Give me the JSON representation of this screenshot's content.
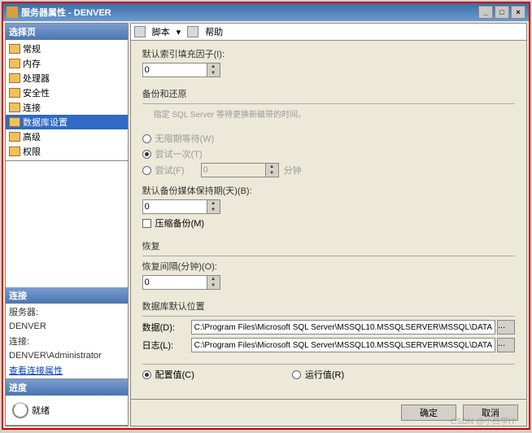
{
  "window": {
    "icon": "server-icon",
    "title": "服务器属性 - DENVER"
  },
  "sidebar": {
    "select_header": "选择页",
    "items": [
      {
        "label": "常规"
      },
      {
        "label": "内存"
      },
      {
        "label": "处理器"
      },
      {
        "label": "安全性"
      },
      {
        "label": "连接"
      },
      {
        "label": "数据库设置"
      },
      {
        "label": "高级"
      },
      {
        "label": "权限"
      }
    ],
    "conn_header": "连接",
    "server_lbl": "服务器:",
    "server_val": "DENVER",
    "conn_lbl": "连接:",
    "conn_val": "DENVER\\Administrator",
    "view_conn": "查看连接属性",
    "progress_header": "进度",
    "progress_status": "就绪"
  },
  "toolbar": {
    "script": "脚本",
    "help": "帮助"
  },
  "main": {
    "fill_factor_lbl": "默认索引填充因子(I):",
    "fill_factor_val": "0",
    "backup_header": "备份和还原",
    "backup_hint": "指定 SQL Server 等待更换新磁带的时间。",
    "radio_wait": "无限期等待(W)",
    "radio_try": "尝试一次(T)",
    "radio_for": "尝试(F)",
    "for_val": "0",
    "for_unit": "分钟",
    "retain_lbl": "默认备份媒体保持期(天)(B):",
    "retain_val": "0",
    "compress_lbl": "压缩备份(M)",
    "recovery_header": "恢复",
    "recovery_lbl": "恢复间隔(分钟)(O):",
    "recovery_val": "0",
    "loc_header": "数据库默认位置",
    "data_lbl": "数据(D):",
    "data_val": "C:\\Program Files\\Microsoft SQL Server\\MSSQL10.MSSQLSERVER\\MSSQL\\DATA",
    "log_lbl": "日志(L):",
    "log_val": "C:\\Program Files\\Microsoft SQL Server\\MSSQL10.MSSQLSERVER\\MSSQL\\DATA",
    "config_radio": "配置值(C)",
    "running_radio": "运行值(R)"
  },
  "footer": {
    "ok": "确定",
    "cancel": "取消"
  },
  "watermark": "CSDN @小白学IT"
}
